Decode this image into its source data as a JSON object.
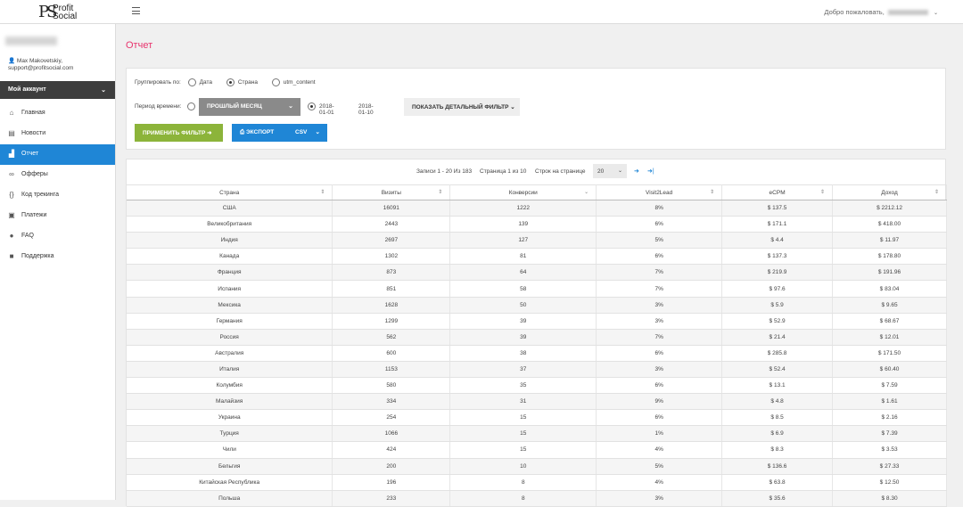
{
  "header": {
    "logo_mark": "PS",
    "logo_line1": "Profit",
    "logo_line2": "Social",
    "welcome": "Добро пожаловать,",
    "caret": "⌄"
  },
  "sidebar": {
    "user_name": "Max Makovetskiy,",
    "user_email": "support@profitsocial.com",
    "account_label": "Мой аккаунт",
    "account_chev": "⌄",
    "items": [
      {
        "label": "Главная",
        "icon": "home-icon",
        "glyph": "⌂"
      },
      {
        "label": "Новости",
        "icon": "news-icon",
        "glyph": "▤"
      },
      {
        "label": "Отчет",
        "icon": "report-icon",
        "glyph": "▟"
      },
      {
        "label": "Офферы",
        "icon": "link-icon",
        "glyph": "∞"
      },
      {
        "label": "Код трекинга",
        "icon": "code-icon",
        "glyph": "{}"
      },
      {
        "label": "Платежи",
        "icon": "payments-icon",
        "glyph": "▣"
      },
      {
        "label": "FAQ",
        "icon": "question-icon",
        "glyph": "●"
      },
      {
        "label": "Поддержка",
        "icon": "chat-icon",
        "glyph": "■"
      }
    ]
  },
  "page": {
    "title": "Отчет"
  },
  "filters": {
    "group_by_label": "Группировать по:",
    "group_options": [
      "Дата",
      "Страна",
      "utm_content"
    ],
    "period_label": "Период времени:",
    "period_value": "ПРОШЛЫЙ МЕСЯЦ",
    "date_from": "2018-01-01",
    "date_to": "2018-01-10",
    "detail_filter": "ПОКАЗАТЬ ДЕТАЛЬНЫЙ ФИЛЬТР ⌄",
    "apply": "ПРИМЕНИТЬ ФИЛЬТР ➜",
    "export": "ЭКСПОРТ",
    "export_format": "CSV",
    "export_caret": "⌄"
  },
  "pager": {
    "records": "Записи 1 - 20 Из 183",
    "page": "Страница 1 из 10",
    "rows_label": "Строк на странице",
    "rows_value": "20",
    "next": "➜",
    "last": "➜|"
  },
  "table": {
    "headers": [
      "Страна",
      "Визиты",
      "Конверсии",
      "Visit2Lead",
      "eCPM",
      "Доход"
    ],
    "rows": [
      [
        "США",
        "16091",
        "1222",
        "8%",
        "$ 137.5",
        "$ 2212.12"
      ],
      [
        "Великобритания",
        "2443",
        "139",
        "6%",
        "$ 171.1",
        "$ 418.00"
      ],
      [
        "Индия",
        "2697",
        "127",
        "5%",
        "$ 4.4",
        "$ 11.97"
      ],
      [
        "Канада",
        "1302",
        "81",
        "6%",
        "$ 137.3",
        "$ 178.80"
      ],
      [
        "Франция",
        "873",
        "64",
        "7%",
        "$ 219.9",
        "$ 191.96"
      ],
      [
        "Испания",
        "851",
        "58",
        "7%",
        "$ 97.6",
        "$ 83.04"
      ],
      [
        "Мексика",
        "1628",
        "50",
        "3%",
        "$ 5.9",
        "$ 9.65"
      ],
      [
        "Германия",
        "1299",
        "39",
        "3%",
        "$ 52.9",
        "$ 68.67"
      ],
      [
        "Россия",
        "562",
        "39",
        "7%",
        "$ 21.4",
        "$ 12.01"
      ],
      [
        "Австралия",
        "600",
        "38",
        "6%",
        "$ 285.8",
        "$ 171.50"
      ],
      [
        "Италия",
        "1153",
        "37",
        "3%",
        "$ 52.4",
        "$ 60.40"
      ],
      [
        "Колумбия",
        "580",
        "35",
        "6%",
        "$ 13.1",
        "$ 7.59"
      ],
      [
        "Малайзия",
        "334",
        "31",
        "9%",
        "$ 4.8",
        "$ 1.61"
      ],
      [
        "Украина",
        "254",
        "15",
        "6%",
        "$ 8.5",
        "$ 2.16"
      ],
      [
        "Турция",
        "1066",
        "15",
        "1%",
        "$ 6.9",
        "$ 7.39"
      ],
      [
        "Чили",
        "424",
        "15",
        "4%",
        "$ 8.3",
        "$ 3.53"
      ],
      [
        "Бельгия",
        "200",
        "10",
        "5%",
        "$ 136.6",
        "$ 27.33"
      ],
      [
        "Китайская Республика",
        "196",
        "8",
        "4%",
        "$ 63.8",
        "$ 12.50"
      ],
      [
        "Польша",
        "233",
        "8",
        "3%",
        "$ 35.6",
        "$ 8.30"
      ]
    ]
  }
}
